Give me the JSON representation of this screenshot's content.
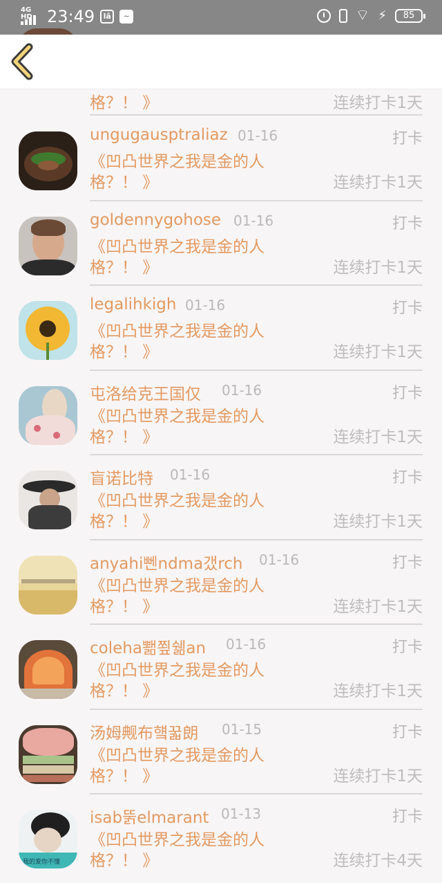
{
  "status_bar": {
    "network": "4G HD",
    "time": "23:49",
    "battery": "85"
  },
  "header": {
    "back_icon": "chevron-left-icon"
  },
  "partial_row": {
    "book_line2": "格？！ 》",
    "streak": "连续打卡1天"
  },
  "rows": [
    {
      "name": "ungugausptraliaz",
      "date": "01-16",
      "action": "打卡",
      "book_line1": "《凹凸世界之我是金的人",
      "book_line2": "格？！ 》",
      "streak": "连续打卡1天",
      "avatar": "food-bowl-image"
    },
    {
      "name": "goldennygohose",
      "date": "01-16",
      "action": "打卡",
      "book_line1": "《凹凸世界之我是金的人",
      "book_line2": "格？！ 》",
      "streak": "连续打卡1天",
      "avatar": "young-man-portrait"
    },
    {
      "name": "legalihkigh",
      "date": "01-16",
      "action": "打卡",
      "book_line1": "《凹凸世界之我是金的人",
      "book_line2": "格？！ 》",
      "streak": "连续打卡1天",
      "avatar": "sunflower-image"
    },
    {
      "name": "屯洛给克王国仅",
      "date": "01-16",
      "action": "打卡",
      "book_line1": "《凹凸世界之我是金的人",
      "book_line2": "格？！ 》",
      "streak": "连续打卡1天",
      "avatar": "girl-floral-dress"
    },
    {
      "name": "盲诺比特",
      "date": "01-16",
      "action": "打卡",
      "book_line1": "《凹凸世界之我是金的人",
      "book_line2": "格？！ 》",
      "streak": "连续打卡1天",
      "avatar": "swordsman-hat"
    },
    {
      "name": "anyahi뻰ndma갰rch",
      "date": "01-16",
      "action": "打卡",
      "book_line1": "《凹凸世界之我是金的人",
      "book_line2": "格？！ 》",
      "streak": "连续打卡1天",
      "avatar": "golden-field-text"
    },
    {
      "name": "coleha뾂쬪쉚an",
      "date": "01-16",
      "action": "打卡",
      "book_line1": "《凹凸世界之我是金的人",
      "book_line2": "格？！ 》",
      "streak": "连续打卡1天",
      "avatar": "seashell-image"
    },
    {
      "name": "汤姆觍布헄꿃朗",
      "date": "01-15",
      "action": "打卡",
      "book_line1": "《凹凸世界之我是金的人",
      "book_line2": "格？！ 》",
      "streak": "连续打卡1天",
      "avatar": "books-flowers"
    },
    {
      "name": "isab뚥elmarant",
      "date": "01-13",
      "action": "打卡",
      "book_line1": "《凹凸世界之我是金的人",
      "book_line2": "格？！ 》",
      "streak": "连续打卡4天",
      "avatar": "girl-reading-teal",
      "avatar_caption": "我的爱你不懂"
    }
  ]
}
